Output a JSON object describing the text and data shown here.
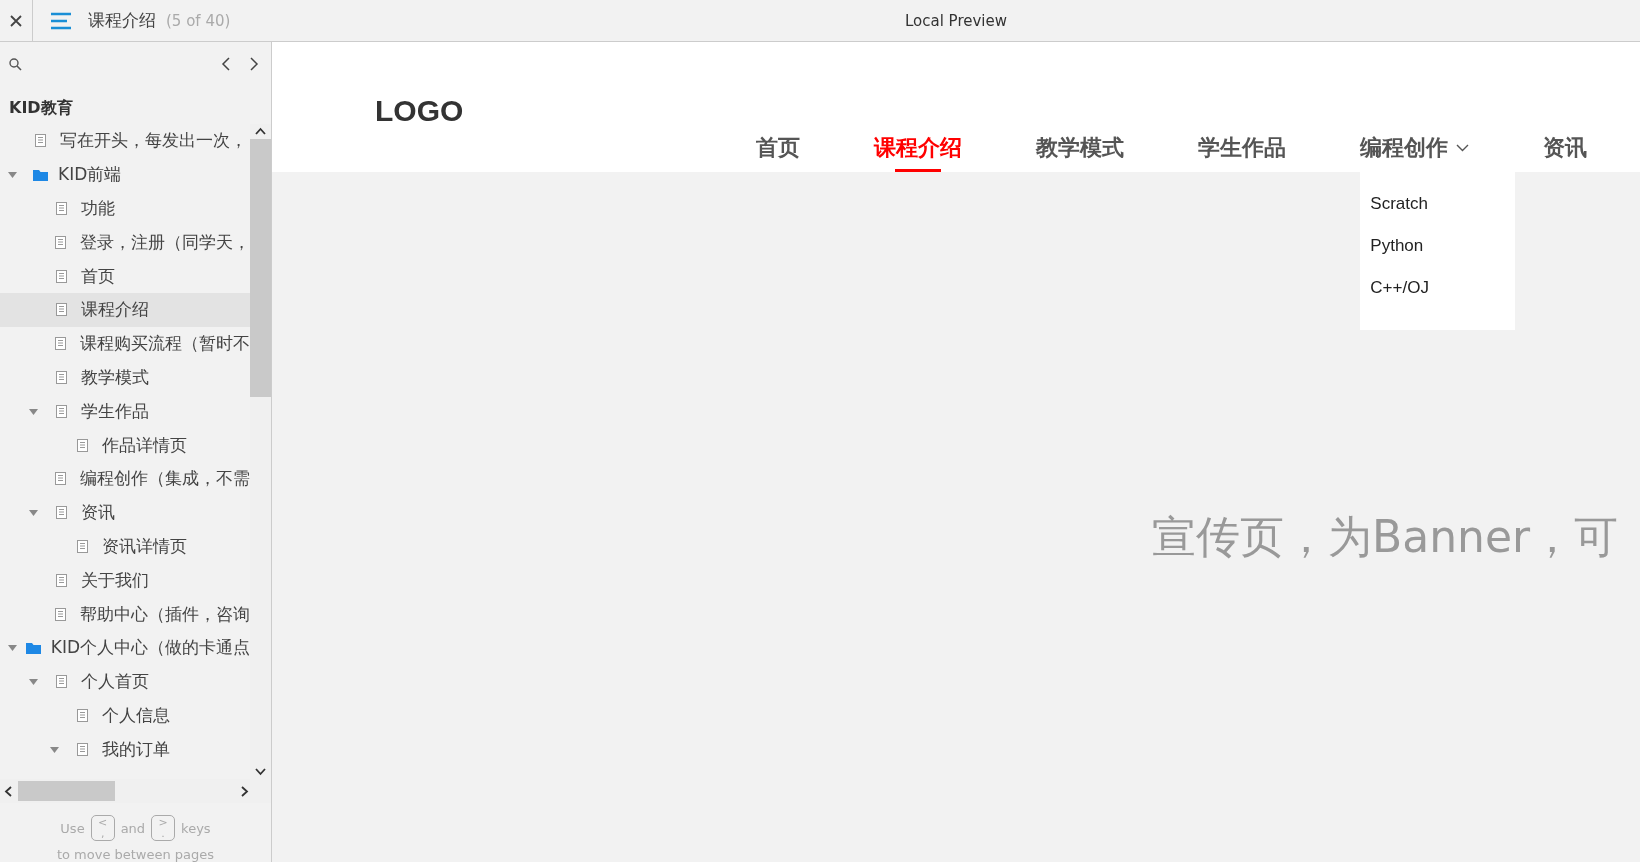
{
  "topbar": {
    "title": "课程介绍",
    "counter": "(5 of 40)",
    "preview_label": "Local Preview"
  },
  "sidebar": {
    "project": "KID教育",
    "tree": [
      {
        "label": "写在开头，每发出一次，",
        "kind": "page",
        "selected": false
      },
      {
        "label": "KID前端",
        "kind": "folder",
        "selected": false,
        "expanded": true,
        "children": [
          {
            "label": "功能",
            "kind": "page",
            "selected": false
          },
          {
            "label": "登录，注册（同学天，",
            "kind": "page",
            "selected": false
          },
          {
            "label": "首页",
            "kind": "page",
            "selected": false
          },
          {
            "label": "课程介绍",
            "kind": "page",
            "selected": true
          },
          {
            "label": "课程购买流程（暂时不",
            "kind": "page",
            "selected": false
          },
          {
            "label": "教学模式",
            "kind": "page",
            "selected": false
          },
          {
            "label": "学生作品",
            "kind": "page",
            "selected": false,
            "expanded": true,
            "children": [
              {
                "label": "作品详情页",
                "kind": "page",
                "selected": false
              }
            ]
          },
          {
            "label": "编程创作（集成，不需",
            "kind": "page",
            "selected": false
          },
          {
            "label": "资讯",
            "kind": "page",
            "selected": false,
            "expanded": true,
            "children": [
              {
                "label": "资讯详情页",
                "kind": "page",
                "selected": false
              }
            ]
          },
          {
            "label": "关于我们",
            "kind": "page",
            "selected": false
          },
          {
            "label": "帮助中心（插件，咨询",
            "kind": "page",
            "selected": false
          }
        ]
      },
      {
        "label": "KID个人中心（做的卡通点",
        "kind": "folder",
        "selected": false,
        "expanded": true,
        "children": [
          {
            "label": "个人首页",
            "kind": "page",
            "selected": false,
            "expanded": true,
            "children": [
              {
                "label": "个人信息",
                "kind": "page",
                "selected": false
              },
              {
                "label": "我的订单",
                "kind": "page",
                "selected": false,
                "expanded": true
              }
            ]
          }
        ]
      }
    ],
    "hint": {
      "use": "Use",
      "key_prev": {
        "top": "<",
        "bottom": ","
      },
      "and": "and",
      "key_next": {
        "top": ">",
        "bottom": "."
      },
      "keys": "keys",
      "line2": "to move between pages"
    }
  },
  "page": {
    "logo": "LOGO",
    "nav": [
      {
        "label": "首页",
        "selected": false
      },
      {
        "label": "课程介绍",
        "selected": true
      },
      {
        "label": "教学模式",
        "selected": false
      },
      {
        "label": "学生作品",
        "selected": false
      },
      {
        "label": "编程创作",
        "selected": false,
        "open": true,
        "menu": [
          "Scratch",
          "Python",
          "C++/OJ"
        ]
      },
      {
        "label": "资讯",
        "selected": false
      }
    ],
    "banner": "宣传页，为Banner，可"
  }
}
